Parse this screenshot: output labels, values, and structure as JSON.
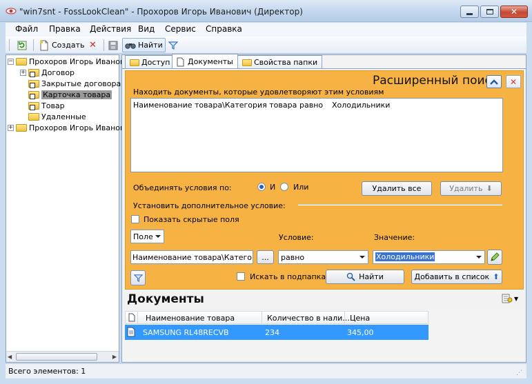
{
  "window": {
    "title": "\"win7snt - FossLookClean\" - Прохоров Игорь Иванович (Директор)"
  },
  "menu": [
    "Файл",
    "Правка",
    "Действия",
    "Вид",
    "Сервис",
    "Справка"
  ],
  "toolbar": {
    "create_label": "Создать",
    "find_label": "Найти"
  },
  "tree": {
    "items": [
      {
        "label": "Прохоров Игорь Иванов"
      },
      {
        "label": "Договор"
      },
      {
        "label": "Закрытые договора"
      },
      {
        "label": "Карточка товара"
      },
      {
        "label": "Товар"
      },
      {
        "label": "Удаленные"
      },
      {
        "label": "Прохоров Игорь Иванов"
      }
    ]
  },
  "tabs": [
    "Доступ",
    "Документы",
    "Свойства папки"
  ],
  "search": {
    "title": "Расширенный поиск",
    "conditions_label": "Находить документы, которые удовлетворяют этим условиям",
    "condition": {
      "field": "Наименование товара\\Категория товара",
      "operator": "равно",
      "value": "Холодильники"
    },
    "combine_label": "Объединять условия по:",
    "and_label": "И",
    "or_label": "Или",
    "delete_all_label": "Удалить все",
    "delete_label": "Удалить",
    "add_condition_label": "Установить дополнительное условие:",
    "show_hidden_label": "Показать скрытые поля",
    "field_dropdown": "Поле",
    "condition_header": "Условие:",
    "value_header": "Значение:",
    "field_value": "Наименование товара\\Категория",
    "browse_label": "...",
    "operator_value": "равно",
    "value_value": "Холодильники",
    "subfolders_label": "Искать в подпапках",
    "find_label": "Найти",
    "add_to_list_label": "Добавить в список"
  },
  "documents": {
    "title": "Документы",
    "columns": [
      "Наименование товара",
      "Количество в нали...",
      "Цена"
    ],
    "rows": [
      [
        "SAMSUNG RL48RECVB",
        "234",
        "345,00"
      ]
    ]
  },
  "status": {
    "text": "Всего элементов: 1"
  }
}
